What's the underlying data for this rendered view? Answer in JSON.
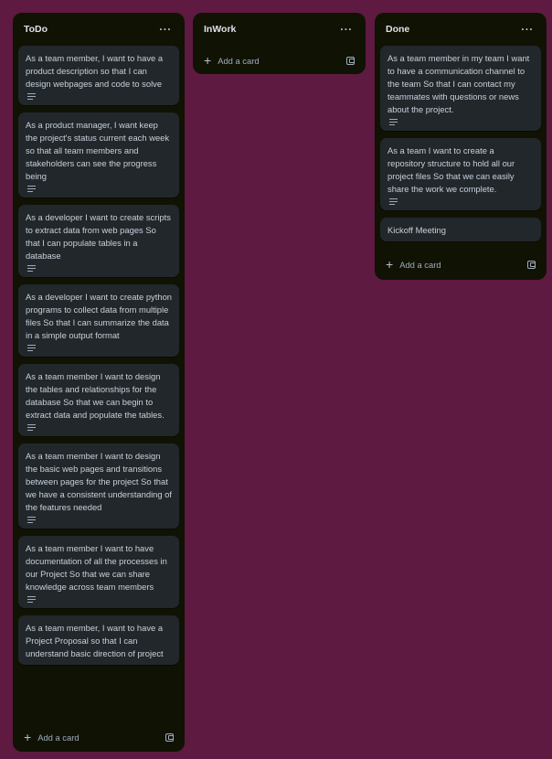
{
  "lists": {
    "todo": {
      "title": "ToDo",
      "menu": "···",
      "cards": [
        {
          "text": "As a team member, I want to have a product description so that I can design webpages and code to solve"
        },
        {
          "text": "As a product manager, I want keep the project's status current each week so that all team members and stakeholders can see the progress being"
        },
        {
          "text": "As a developer I want to create scripts to extract data from web pages So that I can populate tables in a database"
        },
        {
          "text": "As a developer I want to create python programs to collect data from multiple files So that I can summarize the data in a simple output format"
        },
        {
          "text": "As a team member I want to design the tables and relationships for the database So that we can begin to extract data and populate the tables."
        },
        {
          "text": "As a team member I want to design the basic web pages and transitions between pages for the project So that we have a consistent understanding of the features needed"
        },
        {
          "text": "As a team member I want to have documentation of all the processes in our Project So that we can share knowledge across team members"
        },
        {
          "text": "As a team member, I want to have a Project Proposal so that I can understand basic direction of project"
        }
      ],
      "add_label": "Add a card"
    },
    "inwork": {
      "title": "InWork",
      "menu": "···",
      "add_label": "Add a card"
    },
    "done": {
      "title": "Done",
      "menu": "···",
      "cards": [
        {
          "text": "As a team member in my team I want to have a communication channel to the team So that I can contact my teammates with questions or news about the project."
        },
        {
          "text": "As a team I want to create a repository structure to hold all our project files So that we can easily share the work we complete."
        },
        {
          "text": "Kickoff Meeting"
        }
      ],
      "add_label": "Add a card"
    }
  },
  "icons": {
    "plus": "+",
    "description": "description-icon",
    "template": "template-icon"
  },
  "colors": {
    "board_background": "#5e1a40",
    "list_background": "#101204",
    "card_background": "#22272b",
    "card_text": "#c7d1db"
  }
}
